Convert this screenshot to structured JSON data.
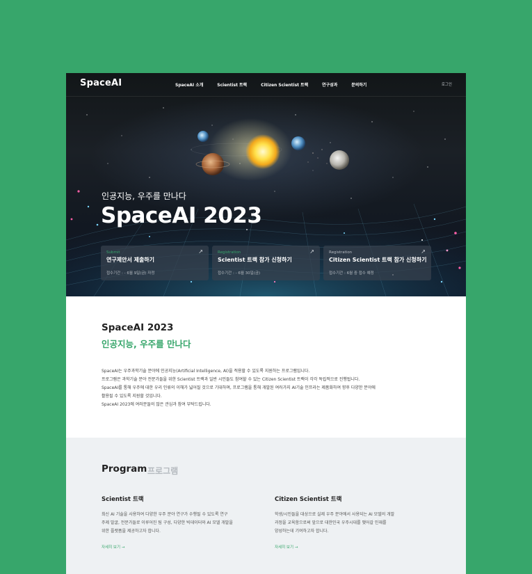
{
  "nav": {
    "logo": "SpaceAI",
    "menu": [
      "SpaceAI 소개",
      "Scientist 트랙",
      "Citizen Scientist 트랙",
      "연구성과",
      "문의하기"
    ],
    "login": "로그인"
  },
  "hero": {
    "subtitle": "인공지능, 우주를 만나다",
    "title": "SpaceAI 2023",
    "cards": [
      {
        "category": "Submit",
        "title": "연구제안서 제출하기",
        "period": "접수기간 : - 6월 9일(금) 자정",
        "arrow": "↗"
      },
      {
        "category": "Registration",
        "title": "Scientist 트랙 참가 신청하기",
        "period": "접수기간 : - 6월 30일(금)",
        "arrow": "↗"
      },
      {
        "category": "Registration",
        "title": "Citizen Scientist 트랙 참가 신청하기",
        "period": "접수기간 : 6월 중 접수 예정",
        "arrow": "↗"
      }
    ]
  },
  "intro": {
    "title": "SpaceAI 2023",
    "subtitle": "인공지능, 우주를 만나다",
    "paragraphs": [
      "SpaceAI는 우주과학기술 분야에 인공지능(Artificial Intelligence, AI)을 적용할 수 있도록 지원하는 프로그램입니다.",
      "프로그램은 과학기술 분야 전문가들을 위한 Scientist 트랙과 일반 시민들도 참여할 수 있는 Citizen Scientist 트랙이 각각 독립적으로 진행됩니다.",
      "SpaceAI를 통해 우주에 대한 우리 인류의 이해가 넓어질 것으로 기대하며, 프로그램을 통해 개발된 여러가지 AI기술 인프라는 제품화하여 향후 다양한 분야에",
      "활용될 수 있도록 지원할 것입니다.",
      "SpaceAI 2023에 여러분들의 많은 관심과 참여 부탁드립니다."
    ]
  },
  "program": {
    "heading": "Program",
    "heading_ko": "프로그램",
    "tracks": [
      {
        "title": "Scientist 트랙",
        "lines": [
          "최신 AI 기술을 사용하여 다양한 우주 분야 연구가 수행될 수 있도록 연구",
          "주제 발굴, 전문가들로 이루어진 팀 구성, 다양한 빅데이터와 AI 모델 개발을",
          "위한 플랫폼을 제공하고자 합니다."
        ],
        "more": "자세히 보기 →"
      },
      {
        "title": "Citizen Scientist 트랙",
        "lines": [
          "학생/시민들을 대상으로 실제 우주 분야에서 사용되는 AI 모델의 개발",
          "과정을 교육함으로써 앞으로 대한민국 우주시대를 맺어갈 인재를",
          "양성하는데 기여하고자 합니다."
        ],
        "more": "자세히 보기 →"
      }
    ]
  },
  "colors": {
    "background": "#37a66b",
    "accent": "#37a66b",
    "hero_dark": "#141a22"
  }
}
